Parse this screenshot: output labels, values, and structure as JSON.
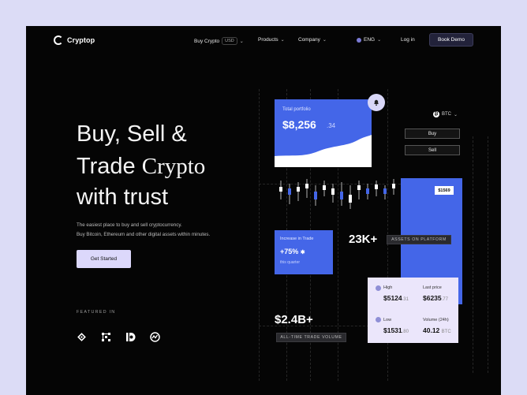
{
  "brand": {
    "name": "Cryptop"
  },
  "nav": {
    "buy_crypto": "Buy Crypto",
    "currency": "USD",
    "products": "Products",
    "company": "Company",
    "language": "ENG",
    "login": "Log in",
    "demo": "Book Demo"
  },
  "hero": {
    "line1": "Buy, Sell &",
    "line2a": "Trade",
    "line2b": "Crypto",
    "line3": "with trust",
    "sub1": "The easiest place to buy and sell cryptocurrency.",
    "sub2": "Buy Bitcoin, Ethereum and other digital assets within minutes.",
    "cta": "Get Started",
    "featured": "FEATURED IN"
  },
  "featured_logos": [
    "binance-icon",
    "blockchain-icon",
    "d-logo-icon",
    "coinmarketcap-icon"
  ],
  "dashboard": {
    "portfolio_label": "Total portfolio",
    "portfolio_value": "$8,256",
    "portfolio_cents": ".34",
    "coin": "BTC",
    "buy": "Buy",
    "sell": "Sell",
    "price_tag": "$1569",
    "trade_label": "Increase in Trade",
    "trade_value": "+75%",
    "trade_sub": "this quarter",
    "assets_value": "23K+",
    "assets_label": "ASSETS ON PLATFORM",
    "volume_value": "$2.4B+",
    "volume_label": "ALL-TIME TRADE VOLUME",
    "accent": "#4466e8"
  },
  "stats": {
    "high_label": "High",
    "high_value": "$5124",
    "high_dec": ".31",
    "last_label": "Last price",
    "last_value": "$6235",
    "last_dec": ".77",
    "low_label": "Low",
    "low_value": "$1531",
    "low_dec": ".80",
    "volume_label": "Volume (24h)",
    "volume_value": "40.12",
    "volume_unit": "BTC"
  }
}
